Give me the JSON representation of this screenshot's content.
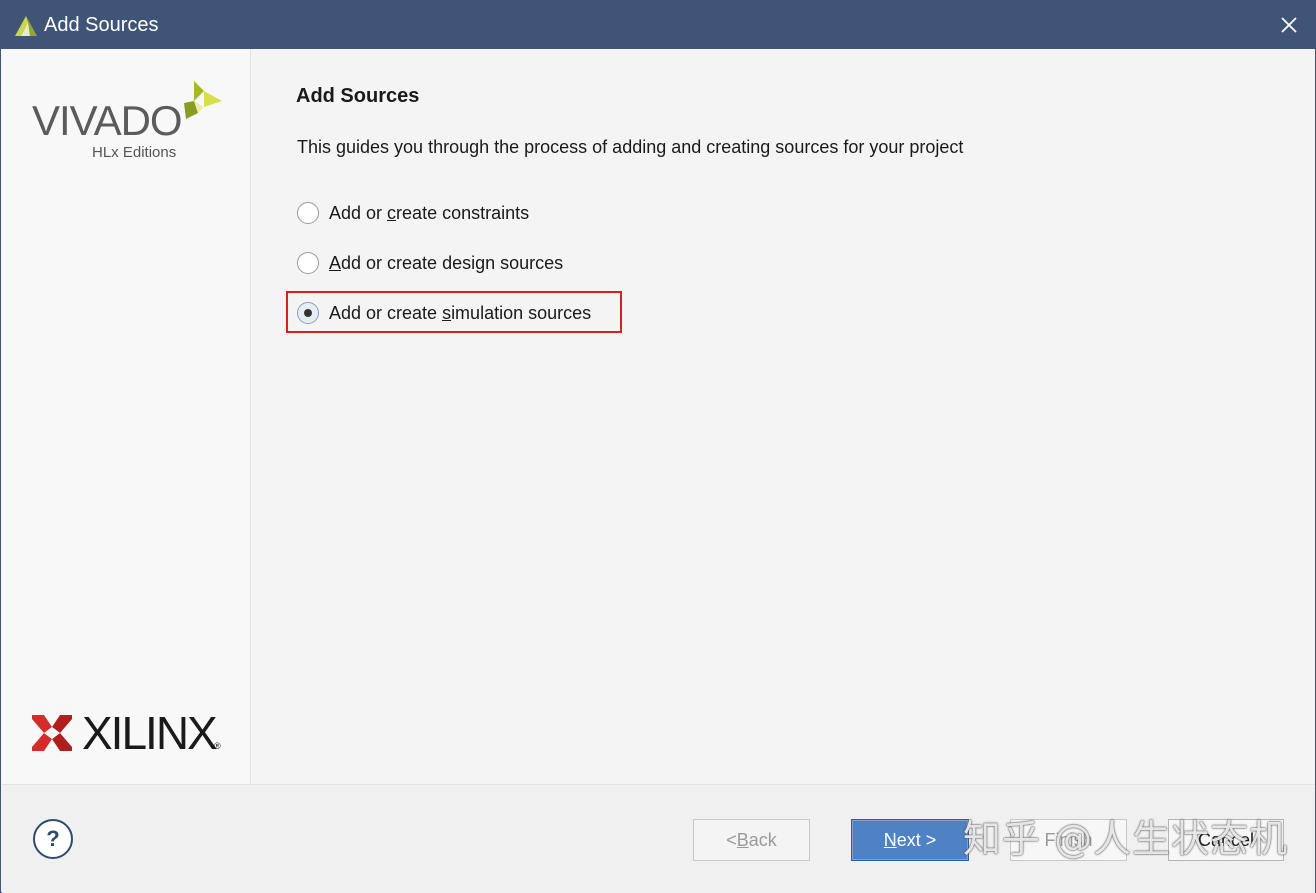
{
  "window": {
    "title": "Add Sources"
  },
  "branding": {
    "product": "VIVADO",
    "edition": "HLx Editions",
    "company": "XILINX",
    "registered": "®"
  },
  "page": {
    "title": "Add Sources",
    "description": "This guides you through the process of adding and creating sources for your project"
  },
  "options": [
    {
      "pre": "Add or ",
      "mnemonic": "c",
      "post": "reate constraints",
      "checked": false
    },
    {
      "pre": "",
      "mnemonic": "A",
      "post": "dd or create design sources",
      "checked": false
    },
    {
      "pre": "Add or create ",
      "mnemonic": "s",
      "post": "imulation sources",
      "checked": true
    }
  ],
  "buttons": {
    "help": "?",
    "back": {
      "pre": "< ",
      "mnemonic": "B",
      "post": "ack"
    },
    "next": {
      "pre": "",
      "mnemonic": "N",
      "post": "ext >"
    },
    "finish": "Finish",
    "cancel": "Cancel"
  },
  "watermark": "知乎 @人生状态机",
  "colors": {
    "titlebar": "#3f5477",
    "highlight": "#d9201a",
    "primary_button": "#4f81c5"
  }
}
